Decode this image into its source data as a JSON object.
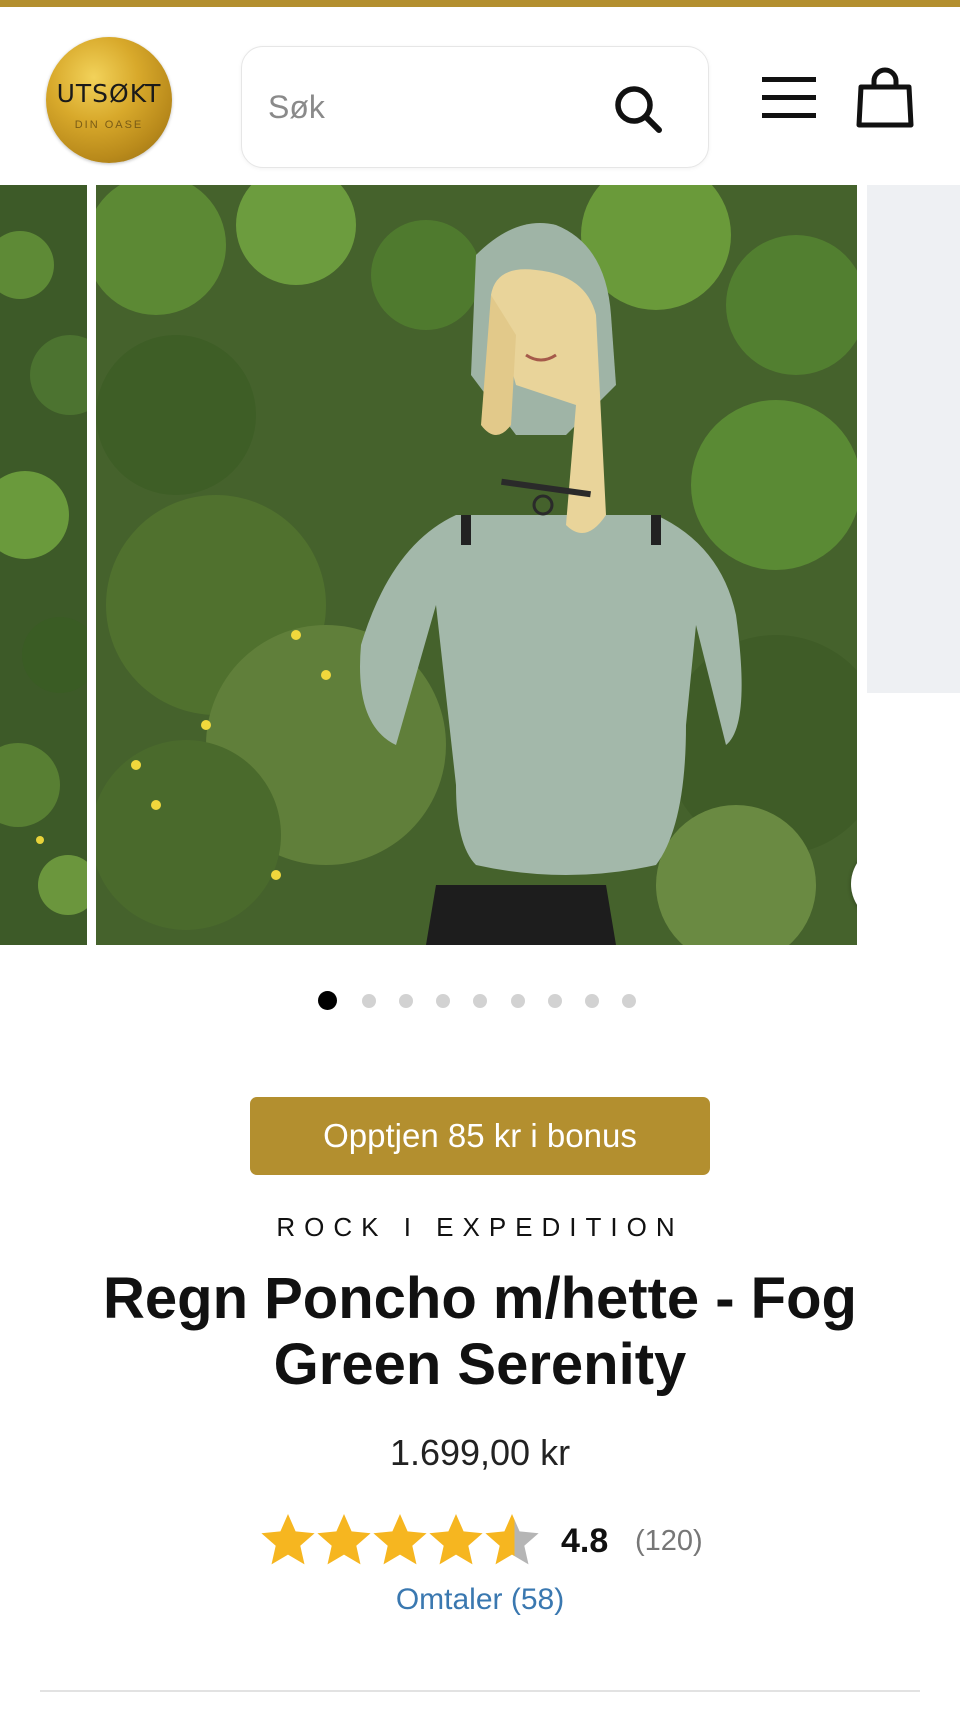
{
  "header": {
    "logo": {
      "title": "UTSØKT",
      "subtitle": "DIN OASE"
    },
    "search": {
      "placeholder": "Søk",
      "icon": "search-icon"
    },
    "menu_icon": "hamburger-menu-icon",
    "cart_icon": "shopping-bag-icon"
  },
  "colors": {
    "accent_gold": "#b38f2f",
    "link_blue": "#3a78b0",
    "star": "#f6b620"
  },
  "gallery": {
    "slide_count": 9,
    "active_index": 0,
    "image_alt": "Woman wearing a fog green rain poncho with hood in front of green shrubbery",
    "zoom_icon": "zoom-icon"
  },
  "product": {
    "bonus_label": "Opptjen 85 kr i bonus",
    "brand": "ROCK I EXPEDITION",
    "title": "Regn Poncho m/hette - Fog Green Serenity",
    "price": "1.699,00 kr",
    "rating": {
      "score": "4.8",
      "count": "(120)",
      "stars_value": 4.8,
      "stars_max": 5
    },
    "reviews_link": "Omtaler (58)"
  }
}
